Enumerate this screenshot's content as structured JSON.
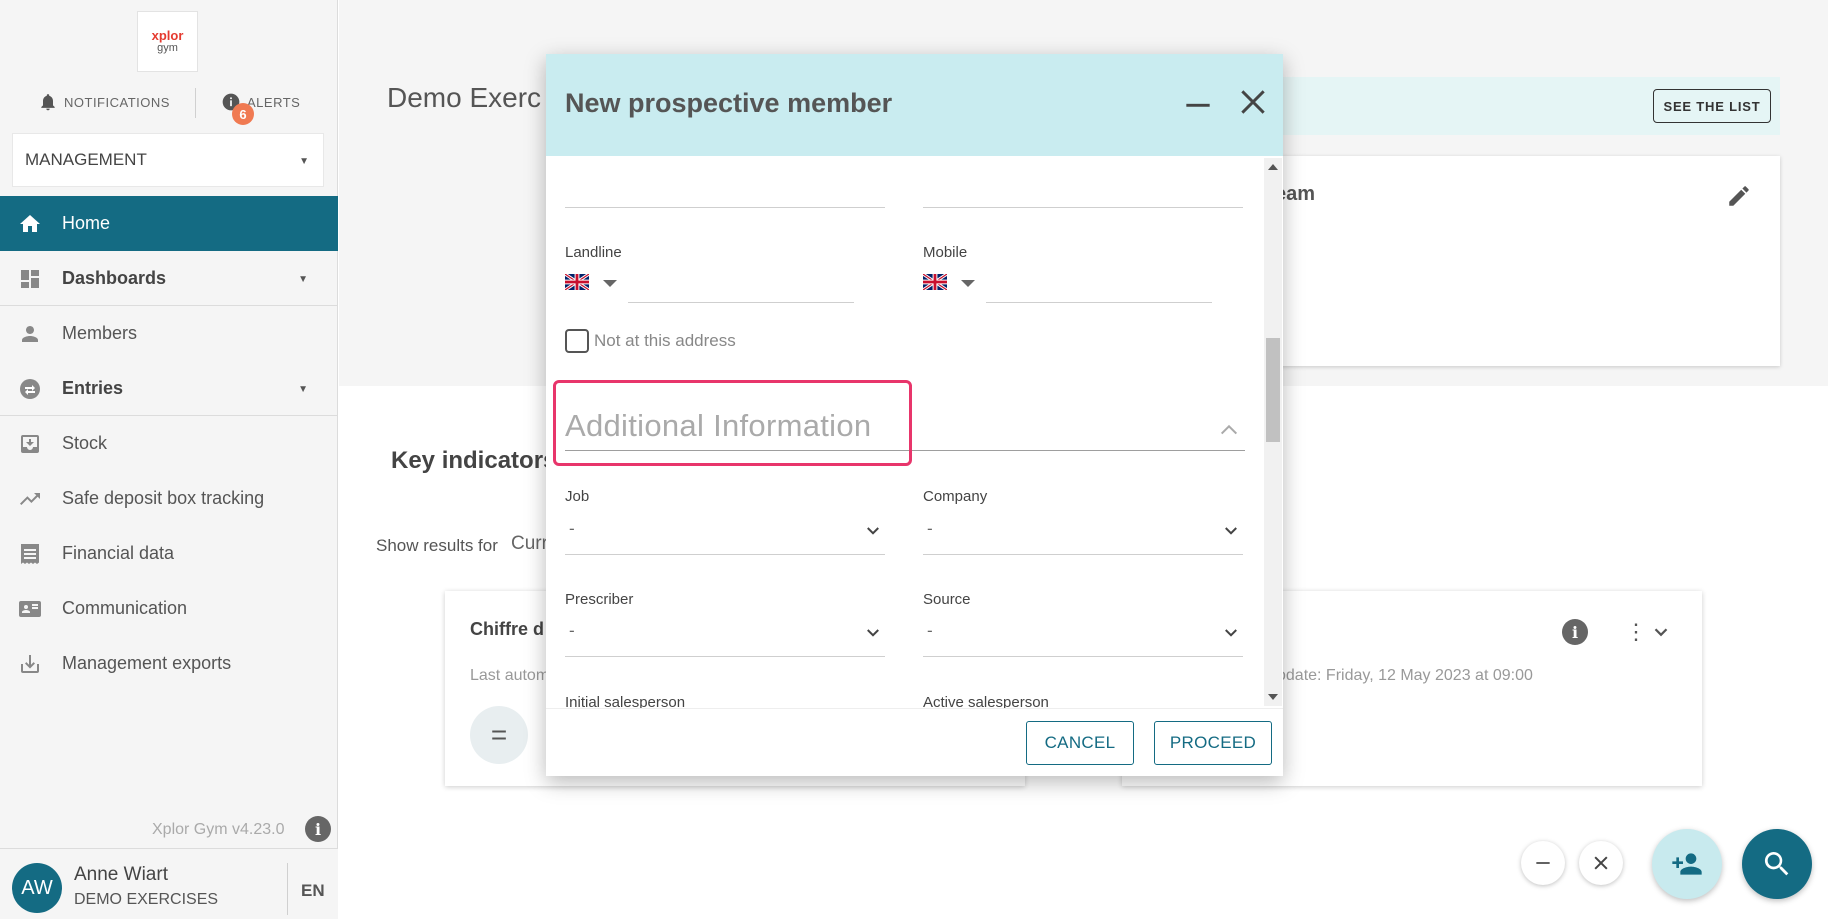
{
  "sidebar": {
    "logo_line1": "xplor",
    "logo_line2": "gym",
    "notifications_label": "NOTIFICATIONS",
    "alerts_label": "ALERTS",
    "alerts_count": "6",
    "management_label": "MANAGEMENT",
    "nav": [
      {
        "label": "Home",
        "icon": "home-icon",
        "active": true
      },
      {
        "label": "Dashboards",
        "icon": "dashboard-icon"
      },
      {
        "label": "Members",
        "icon": "person-icon"
      },
      {
        "label": "Entries",
        "icon": "entries-icon"
      },
      {
        "label": "Stock",
        "icon": "stock-icon"
      },
      {
        "label": "Safe deposit box tracking",
        "icon": "trending-icon"
      },
      {
        "label": "Financial data",
        "icon": "receipt-icon"
      },
      {
        "label": "Communication",
        "icon": "contact-card-icon"
      },
      {
        "label": "Management exports",
        "icon": "download-icon"
      }
    ],
    "version": "Xplor Gym v4.23.0",
    "user": {
      "initials": "AW",
      "name": "Anne Wiart",
      "org": "DEMO EXERCISES"
    },
    "language": "EN"
  },
  "main": {
    "title_partial": "Demo Exerc",
    "see_list_label": "SEE THE LIST",
    "team_partial": "eam",
    "key_indicators_partial": "Key indicators",
    "show_results_label": "Show results for",
    "show_results_value_partial": "Curr",
    "card_left": {
      "title_partial": "Chiffre d",
      "subtitle_partial": "Last autom"
    },
    "card_right": {
      "subtitle_partial": "odate: Friday, 12 May 2023 at 09:00"
    }
  },
  "modal": {
    "title": "New prospective member",
    "fields": {
      "landline_label": "Landline",
      "mobile_label": "Mobile",
      "not_at_address_label": "Not at this address",
      "section_title": "Additional Information",
      "job_label": "Job",
      "job_value": "-",
      "company_label": "Company",
      "company_value": "-",
      "prescriber_label": "Prescriber",
      "prescriber_value": "-",
      "source_label": "Source",
      "source_value": "-",
      "initial_salesperson_label": "Initial salesperson",
      "active_salesperson_label": "Active salesperson"
    },
    "cancel_label": "CANCEL",
    "proceed_label": "PROCEED"
  },
  "colors": {
    "primary": "#146b83",
    "modal_header": "#c9ecf0",
    "highlight": "#e8356b",
    "badge": "#f07a52"
  }
}
